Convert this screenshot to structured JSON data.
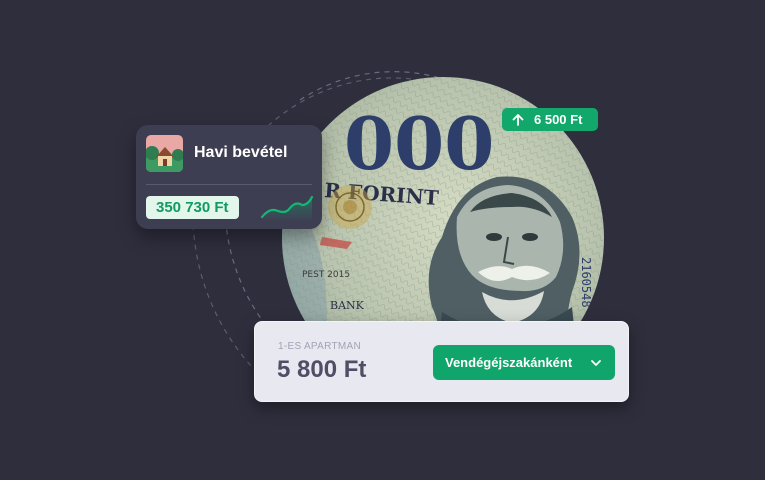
{
  "income_card": {
    "title": "Havi bevétel",
    "amount": "350 730 Ft",
    "thumbnail_icon": "house-icon",
    "trend_icon": "trend-up-icon"
  },
  "badge": {
    "value": "6 500 Ft",
    "icon": "arrow-up-icon"
  },
  "banknote": {
    "denomination_text": "000",
    "currency_text": "R FORINT",
    "serial": "2160548",
    "bottom_text_1": "PEST 2015",
    "bottom_text_2": "BANK"
  },
  "booking": {
    "caption": "1-ES APARTMAN",
    "price": "5 800 Ft",
    "select_value": "Vendégéjszakánként",
    "select_icon": "chevron-down-icon"
  },
  "colors": {
    "background": "#2e2e3d",
    "accent_green": "#12a86b",
    "card_dark": "#3e3e52",
    "card_light": "#e8e8f0"
  }
}
